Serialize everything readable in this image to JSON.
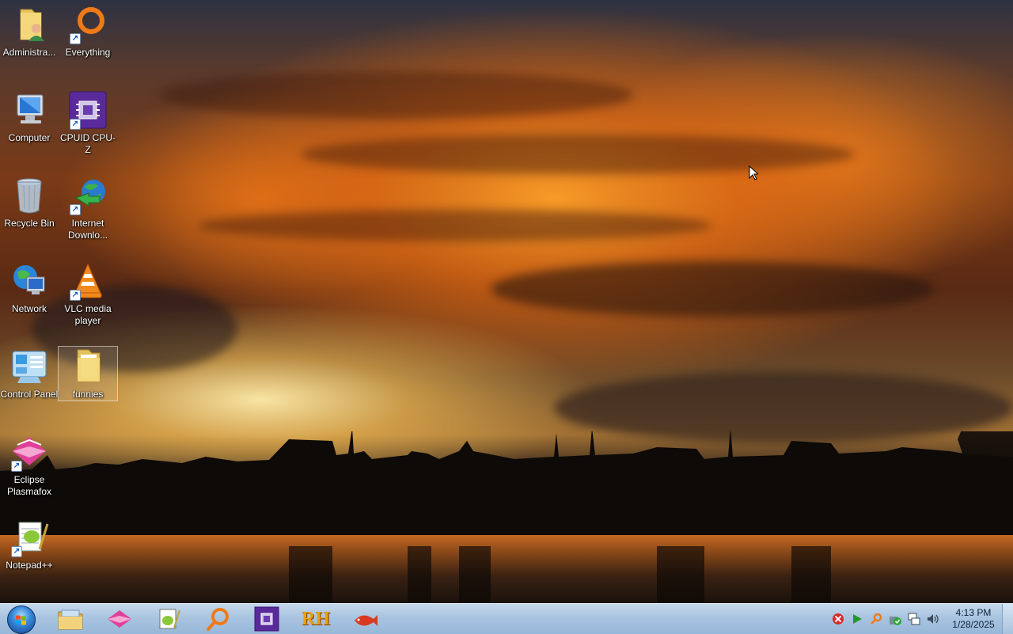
{
  "desktop": {
    "icons": [
      {
        "label": "Administra...",
        "icon": "user-folder-icon"
      },
      {
        "label": "Everything",
        "icon": "everything-search-icon"
      },
      {
        "label": "Computer",
        "icon": "computer-icon"
      },
      {
        "label": "CPUID CPU-Z",
        "icon": "cpuz-icon"
      },
      {
        "label": "Recycle Bin",
        "icon": "recycle-bin-icon"
      },
      {
        "label": "Internet Downlo...",
        "icon": "internet-download-manager-icon"
      },
      {
        "label": "Network",
        "icon": "network-icon"
      },
      {
        "label": "VLC media player",
        "icon": "vlc-icon"
      },
      {
        "label": "Control Panel",
        "icon": "control-panel-icon"
      },
      {
        "label": "funnies",
        "icon": "folder-icon"
      },
      {
        "label": "Eclipse Plasmafox",
        "icon": "plasmafox-icon"
      },
      {
        "label": "Notepad++",
        "icon": "notepad-plus-plus-icon"
      }
    ]
  },
  "taskbar": {
    "start": {
      "icon": "windows-start-orb-icon"
    },
    "pinned": [
      {
        "icon": "file-explorer-icon"
      },
      {
        "icon": "plasmafox-icon"
      },
      {
        "icon": "notepad-plus-plus-icon"
      },
      {
        "icon": "everything-search-icon"
      },
      {
        "icon": "cpuz-icon"
      },
      {
        "text": "RH",
        "icon": "resource-hacker-icon"
      },
      {
        "icon": "red-fish-icon"
      }
    ],
    "tray": [
      {
        "icon": "no-connection-icon"
      },
      {
        "icon": "play-icon"
      },
      {
        "icon": "search-tray-icon"
      },
      {
        "icon": "shield-check-icon"
      },
      {
        "icon": "network-tray-icon"
      },
      {
        "icon": "volume-icon"
      }
    ],
    "clock": {
      "time": "4:13 PM",
      "date": "1/28/2025"
    }
  },
  "colors": {
    "taskbar": "#a9c4e0",
    "label_text": "#ffffff",
    "vlc_orange": "#f08a1c",
    "plasmafox_pink": "#e0409a"
  }
}
